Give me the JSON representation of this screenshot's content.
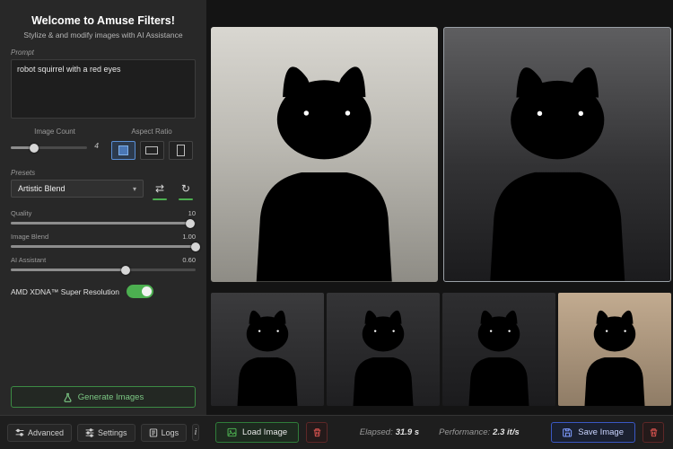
{
  "sidebar": {
    "title": "Welcome to Amuse Filters!",
    "subtitle": "Stylize & and modify images with AI Assistance",
    "prompt": {
      "label": "Prompt",
      "value": "robot squirrel with a red eyes"
    },
    "image_count": {
      "label": "Image Count",
      "value": "4",
      "percent": 30
    },
    "aspect_ratio": {
      "label": "Aspect Ratio"
    },
    "presets": {
      "label": "Presets",
      "selected": "Artistic Blend",
      "chevron": "▾"
    },
    "quality": {
      "label": "Quality",
      "value": "10",
      "percent": 97
    },
    "image_blend": {
      "label": "Image Blend",
      "value": "1.00",
      "percent": 100
    },
    "ai_assistant": {
      "label": "AI Assistant",
      "value": "0.60",
      "percent": 62
    },
    "super_resolution": {
      "label": "AMD XDNA™ Super Resolution",
      "state": "on"
    },
    "generate_label": "Generate Images",
    "shuffle_glyph": "⇄",
    "refresh_glyph": "↻"
  },
  "statusbar": {
    "advanced": "Advanced",
    "settings": "Settings",
    "logs": "Logs",
    "info": "i"
  },
  "toolbar": {
    "load": "Load Image",
    "elapsed_label": "Elapsed:",
    "elapsed_value": "31.9 s",
    "performance_label": "Performance:",
    "performance_value": "2.3 it/s",
    "save": "Save Image"
  },
  "colors": {
    "accent_green": "#4caf50",
    "accent_blue": "#3a57c4",
    "danger_red": "#d9534f",
    "selected_aspect_blue": "#5a8fd6"
  }
}
